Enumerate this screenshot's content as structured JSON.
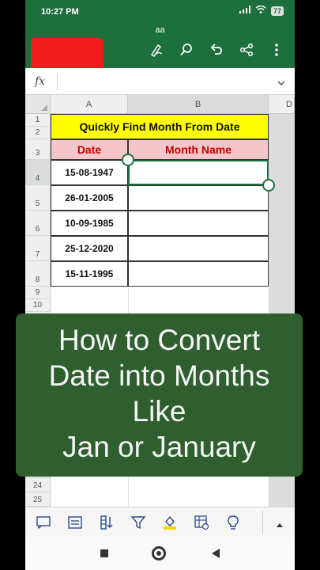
{
  "status": {
    "time": "10:27 PM",
    "battery": "77"
  },
  "app": {
    "doc_name": "aa"
  },
  "formula": {
    "fx_label": "fx",
    "value": ""
  },
  "sheet": {
    "columns": [
      "A",
      "B",
      "D"
    ],
    "rows": [
      "1",
      "2",
      "3",
      "4",
      "5",
      "6",
      "7",
      "8",
      "9",
      "10",
      "24",
      "25"
    ],
    "selected_row": "4",
    "title": "Quickly Find Month From Date",
    "headers": {
      "date": "Date",
      "month_name": "Month Name"
    },
    "dates": [
      "15-08-1947",
      "26-01-2005",
      "10-09-1985",
      "25-12-2020",
      "15-11-1995"
    ],
    "month_names": [
      "",
      "",
      "",
      "",
      ""
    ]
  },
  "overlay": {
    "lines": [
      "How to Convert",
      "Date into Months",
      "Like",
      "Jan or January"
    ],
    "background": "#2f5f2f"
  },
  "toolbar": {
    "icons": [
      "comments-icon",
      "card-view-icon",
      "sort-icon",
      "filter-icon",
      "fill-color-icon",
      "insert-table-icon",
      "idea-icon",
      "expand-up-icon"
    ]
  },
  "colors": {
    "brand": "#1e6f3e",
    "title_fill": "#ffff00",
    "header_fill": "#f4c6c9",
    "header_text": "#c00000",
    "red_block": "#ee1c1c"
  }
}
